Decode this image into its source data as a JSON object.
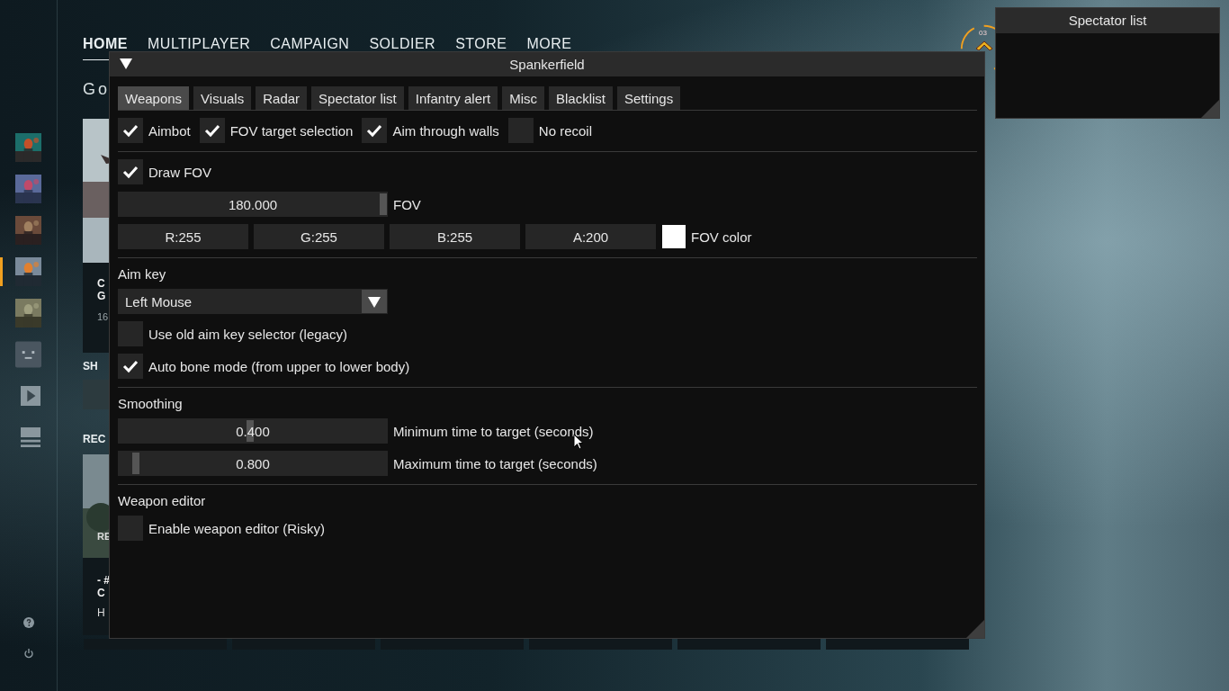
{
  "game_nav": [
    {
      "label": "HOME",
      "selected": true
    },
    {
      "label": "MULTIPLAYER",
      "selected": false
    },
    {
      "label": "CAMPAIGN",
      "selected": false
    },
    {
      "label": "SOLDIER",
      "selected": false
    },
    {
      "label": "STORE",
      "selected": false
    },
    {
      "label": "MORE",
      "selected": false
    }
  ],
  "game_sidebar": {
    "items": [
      {
        "kind": "picture",
        "selected": false
      },
      {
        "kind": "picture",
        "selected": false
      },
      {
        "kind": "picture",
        "selected": false
      },
      {
        "kind": "picture",
        "selected": true
      },
      {
        "kind": "picture",
        "selected": false
      },
      {
        "kind": "face",
        "selected": false
      },
      {
        "kind": "play",
        "selected": false
      },
      {
        "kind": "list",
        "selected": false
      }
    ]
  },
  "greeting": "Go",
  "feature_card": {
    "lines": [
      "C",
      "G"
    ],
    "meta": "16"
  },
  "shop_heading": "SH",
  "recent_heading": "REC",
  "recent_card": {
    "badge": "RE",
    "lines": [
      "- #",
      "C"
    ],
    "meta": "H"
  },
  "rank_badge": "03",
  "menu": {
    "title": "Spankerfield",
    "collapsed": false,
    "tabs": [
      {
        "label": "Weapons",
        "selected": true
      },
      {
        "label": "Visuals",
        "selected": false
      },
      {
        "label": "Radar",
        "selected": false
      },
      {
        "label": "Spectator list",
        "selected": false
      },
      {
        "label": "Infantry alert",
        "selected": false
      },
      {
        "label": "Misc",
        "selected": false
      },
      {
        "label": "Blacklist",
        "selected": false
      },
      {
        "label": "Settings",
        "selected": false
      }
    ],
    "sections": [
      {
        "rows": [
          {
            "kind": "checkboxes",
            "items": [
              {
                "label": "Aimbot",
                "checked": true
              },
              {
                "label": "FOV target selection",
                "checked": true
              },
              {
                "label": "Aim through walls",
                "checked": true
              },
              {
                "label": "No recoil",
                "checked": false
              }
            ]
          }
        ]
      },
      {
        "rows": [
          {
            "kind": "checkboxes",
            "items": [
              {
                "label": "Draw FOV",
                "checked": true
              }
            ]
          },
          {
            "kind": "slider",
            "value": "180.000",
            "label": "FOV",
            "level": 1
          },
          {
            "kind": "color",
            "channels": [
              "R:255",
              "G:255",
              "B:255",
              "A:200"
            ],
            "color": "#ffffff",
            "label": "FOV color"
          }
        ]
      },
      {
        "heading": "Aim key",
        "rows": [
          {
            "kind": "dropdown",
            "value": "Left Mouse"
          },
          {
            "kind": "checkboxes",
            "items": [
              {
                "label": "Use old aim key selector (legacy)",
                "checked": false
              }
            ]
          },
          {
            "kind": "checkboxes",
            "items": [
              {
                "label": "Auto bone mode (from upper to lower body)",
                "checked": true
              }
            ]
          }
        ]
      },
      {
        "heading": "Smoothing",
        "rows": [
          {
            "kind": "slider",
            "value": "0.400",
            "label": "Minimum time to target (seconds)",
            "level": 0.49
          },
          {
            "kind": "slider",
            "value": "0.800",
            "label": "Maximum time to target (seconds)",
            "level": 0.05
          }
        ]
      },
      {
        "heading": "Weapon editor",
        "rows": [
          {
            "kind": "checkboxes",
            "items": [
              {
                "label": "Enable weapon editor (Risky)",
                "checked": false
              }
            ]
          }
        ]
      }
    ]
  },
  "spectator_window": {
    "title": "Spectator list"
  }
}
